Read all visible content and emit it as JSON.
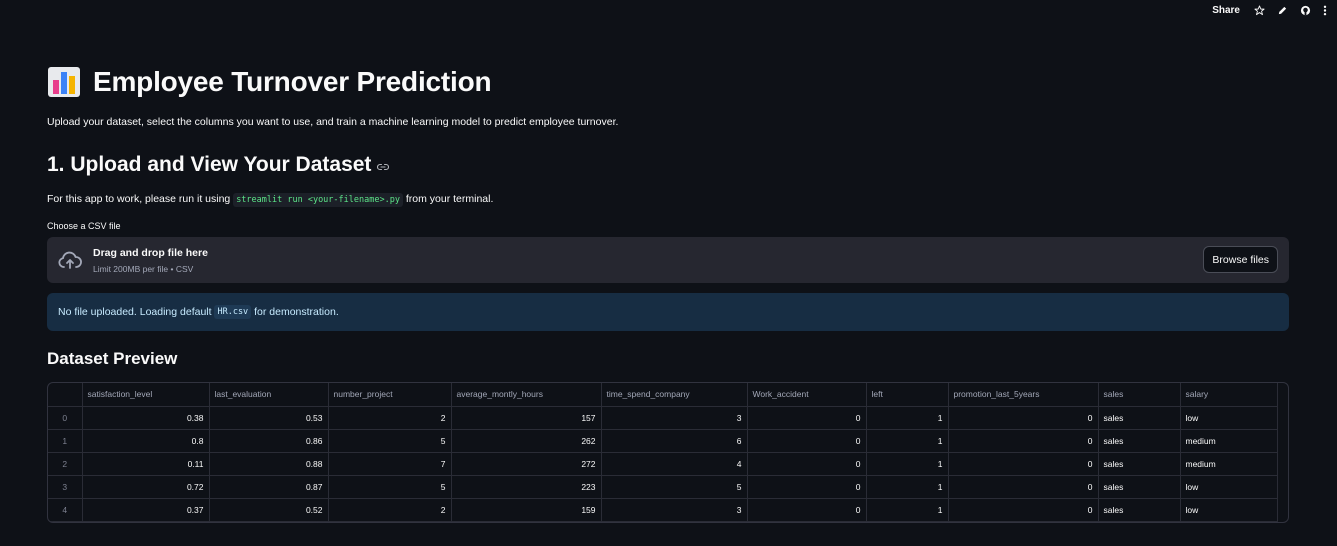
{
  "toolbar": {
    "share_label": "Share"
  },
  "header": {
    "title": "Employee Turnover Prediction",
    "subtitle": "Upload your dataset, select the columns you want to use, and train a machine learning model to predict employee turnover."
  },
  "section1": {
    "heading": "1. Upload and View Your Dataset",
    "para_prefix": "For this app to work, please run it using",
    "para_code": "streamlit run <your-filename>.py",
    "para_suffix": "from your terminal."
  },
  "uploader": {
    "label": "Choose a CSV file",
    "drop_title": "Drag and drop file here",
    "drop_sub": "Limit 200MB per file • CSV",
    "browse_label": "Browse files"
  },
  "info": {
    "prefix": "No file uploaded. Loading default",
    "code": "HR.csv",
    "suffix": "for demonstration."
  },
  "preview": {
    "heading": "Dataset Preview",
    "columns": [
      "satisfaction_level",
      "last_evaluation",
      "number_project",
      "average_montly_hours",
      "time_spend_company",
      "Work_accident",
      "left",
      "promotion_last_5years",
      "sales",
      "salary"
    ],
    "rows": [
      [
        "0",
        "0.38",
        "0.53",
        "2",
        "157",
        "3",
        "0",
        "1",
        "0",
        "sales",
        "low"
      ],
      [
        "1",
        "0.8",
        "0.86",
        "5",
        "262",
        "6",
        "0",
        "1",
        "0",
        "sales",
        "medium"
      ],
      [
        "2",
        "0.11",
        "0.88",
        "7",
        "272",
        "4",
        "0",
        "1",
        "0",
        "sales",
        "medium"
      ],
      [
        "3",
        "0.72",
        "0.87",
        "5",
        "223",
        "5",
        "0",
        "1",
        "0",
        "sales",
        "low"
      ],
      [
        "4",
        "0.37",
        "0.52",
        "2",
        "159",
        "3",
        "0",
        "1",
        "0",
        "sales",
        "low"
      ]
    ]
  }
}
